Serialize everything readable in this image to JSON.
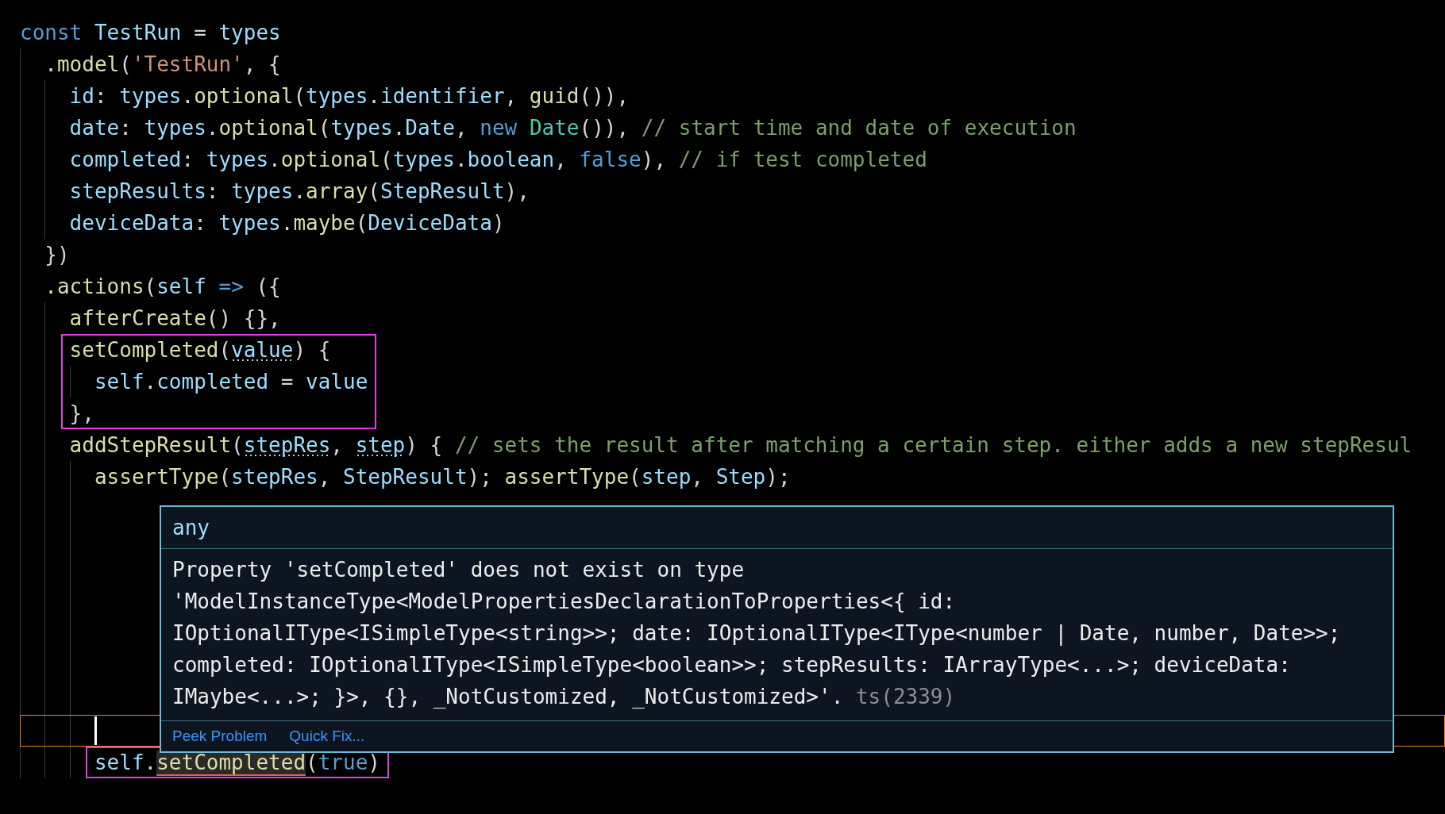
{
  "code_lines": [
    {
      "boxed": false,
      "tokens": [
        {
          "text": "const ",
          "kind": "kw"
        },
        {
          "text": "TestRun",
          "kind": "var"
        },
        {
          "text": " = ",
          "kind": "plain"
        },
        {
          "text": "types",
          "kind": "var"
        }
      ]
    },
    {
      "boxed": false,
      "tokens": [
        {
          "text": "  .model",
          "kind": "fn"
        },
        {
          "text": "(",
          "kind": "plain"
        },
        {
          "text": "'TestRun'",
          "kind": "str"
        },
        {
          "text": ", {",
          "kind": "plain"
        }
      ]
    },
    {
      "boxed": false,
      "tokens": [
        {
          "text": "    id",
          "kind": "var"
        },
        {
          "text": ": ",
          "kind": "plain"
        },
        {
          "text": "types",
          "kind": "var"
        },
        {
          "text": ".",
          "kind": "plain"
        },
        {
          "text": "optional",
          "kind": "fn"
        },
        {
          "text": "(",
          "kind": "plain"
        },
        {
          "text": "types",
          "kind": "var"
        },
        {
          "text": ".",
          "kind": "plain"
        },
        {
          "text": "identifier",
          "kind": "var"
        },
        {
          "text": ", ",
          "kind": "plain"
        },
        {
          "text": "guid",
          "kind": "fn"
        },
        {
          "text": "()),",
          "kind": "plain"
        }
      ]
    },
    {
      "boxed": false,
      "tokens": [
        {
          "text": "    date",
          "kind": "var"
        },
        {
          "text": ": ",
          "kind": "plain"
        },
        {
          "text": "types",
          "kind": "var"
        },
        {
          "text": ".",
          "kind": "plain"
        },
        {
          "text": "optional",
          "kind": "fn"
        },
        {
          "text": "(",
          "kind": "plain"
        },
        {
          "text": "types",
          "kind": "var"
        },
        {
          "text": ".",
          "kind": "plain"
        },
        {
          "text": "Date",
          "kind": "var"
        },
        {
          "text": ", ",
          "kind": "plain"
        },
        {
          "text": "new ",
          "kind": "kw"
        },
        {
          "text": "Date",
          "kind": "type"
        },
        {
          "text": "()), ",
          "kind": "plain"
        },
        {
          "text": "// start time and date of execution",
          "kind": "cmt"
        }
      ]
    },
    {
      "boxed": false,
      "tokens": [
        {
          "text": "    completed",
          "kind": "var"
        },
        {
          "text": ": ",
          "kind": "plain"
        },
        {
          "text": "types",
          "kind": "var"
        },
        {
          "text": ".",
          "kind": "plain"
        },
        {
          "text": "optional",
          "kind": "fn"
        },
        {
          "text": "(",
          "kind": "plain"
        },
        {
          "text": "types",
          "kind": "var"
        },
        {
          "text": ".",
          "kind": "plain"
        },
        {
          "text": "boolean",
          "kind": "var"
        },
        {
          "text": ", ",
          "kind": "plain"
        },
        {
          "text": "false",
          "kind": "kw"
        },
        {
          "text": "), ",
          "kind": "plain"
        },
        {
          "text": "// if test completed",
          "kind": "cmt"
        }
      ]
    },
    {
      "boxed": false,
      "tokens": [
        {
          "text": "    stepResults",
          "kind": "var"
        },
        {
          "text": ": ",
          "kind": "plain"
        },
        {
          "text": "types",
          "kind": "var"
        },
        {
          "text": ".",
          "kind": "plain"
        },
        {
          "text": "array",
          "kind": "fn"
        },
        {
          "text": "(",
          "kind": "plain"
        },
        {
          "text": "StepResult",
          "kind": "var"
        },
        {
          "text": "),",
          "kind": "plain"
        }
      ]
    },
    {
      "boxed": false,
      "tokens": [
        {
          "text": "    deviceData",
          "kind": "var"
        },
        {
          "text": ": ",
          "kind": "plain"
        },
        {
          "text": "types",
          "kind": "var"
        },
        {
          "text": ".",
          "kind": "plain"
        },
        {
          "text": "maybe",
          "kind": "fn"
        },
        {
          "text": "(",
          "kind": "plain"
        },
        {
          "text": "DeviceData",
          "kind": "var"
        },
        {
          "text": ")",
          "kind": "plain"
        }
      ]
    },
    {
      "boxed": false,
      "tokens": [
        {
          "text": "  })",
          "kind": "plain"
        }
      ]
    },
    {
      "boxed": false,
      "tokens": [
        {
          "text": "  .actions",
          "kind": "fn"
        },
        {
          "text": "(",
          "kind": "plain"
        },
        {
          "text": "self ",
          "kind": "var"
        },
        {
          "text": "=>",
          "kind": "kw"
        },
        {
          "text": " ({",
          "kind": "plain"
        }
      ]
    },
    {
      "boxed": false,
      "tokens": [
        {
          "text": "    afterCreate",
          "kind": "fn"
        },
        {
          "text": "() {},",
          "kind": "plain"
        }
      ]
    },
    {
      "boxed": true,
      "tokens": [
        {
          "text": "    setCompleted",
          "kind": "fn"
        },
        {
          "text": "(",
          "kind": "plain"
        },
        {
          "text": "value",
          "kind": "param"
        },
        {
          "text": ") {",
          "kind": "plain"
        }
      ]
    },
    {
      "boxed": true,
      "tokens": [
        {
          "text": "      self",
          "kind": "var"
        },
        {
          "text": ".",
          "kind": "plain"
        },
        {
          "text": "completed",
          "kind": "var"
        },
        {
          "text": " = ",
          "kind": "plain"
        },
        {
          "text": "value",
          "kind": "var"
        }
      ]
    },
    {
      "boxed": true,
      "tokens": [
        {
          "text": "    },",
          "kind": "plain"
        }
      ]
    },
    {
      "boxed": false,
      "tokens": [
        {
          "text": "    addStepResult",
          "kind": "fn"
        },
        {
          "text": "(",
          "kind": "plain"
        },
        {
          "text": "stepRes",
          "kind": "param"
        },
        {
          "text": ", ",
          "kind": "plain"
        },
        {
          "text": "step",
          "kind": "param"
        },
        {
          "text": ") { ",
          "kind": "plain"
        },
        {
          "text": "// sets the result after matching a certain step. either adds a new stepResul",
          "kind": "cmt"
        }
      ]
    },
    {
      "boxed": false,
      "tokens": [
        {
          "text": "      assertType",
          "kind": "fn"
        },
        {
          "text": "(",
          "kind": "plain"
        },
        {
          "text": "stepRes",
          "kind": "var"
        },
        {
          "text": ", ",
          "kind": "plain"
        },
        {
          "text": "StepResult",
          "kind": "var"
        },
        {
          "text": "); ",
          "kind": "plain"
        },
        {
          "text": "assertType",
          "kind": "fn"
        },
        {
          "text": "(",
          "kind": "plain"
        },
        {
          "text": "step",
          "kind": "var"
        },
        {
          "text": ", ",
          "kind": "plain"
        },
        {
          "text": "Step",
          "kind": "var"
        },
        {
          "text": ");",
          "kind": "plain"
        }
      ]
    }
  ],
  "code_lines_after_gap": [
    {
      "boxed": true,
      "tokens": [
        {
          "text": "      self",
          "kind": "var"
        },
        {
          "text": ".",
          "kind": "plain"
        },
        {
          "text": "setCompleted",
          "kind": "error"
        },
        {
          "text": "(",
          "kind": "plain"
        },
        {
          "text": "true",
          "kind": "kw"
        },
        {
          "text": ")",
          "kind": "plain"
        }
      ]
    }
  ],
  "hover": {
    "type": "any",
    "message": "Property 'setCompleted' does not exist on type 'ModelInstanceType<ModelPropertiesDeclarationToProperties<{ id: IOptionalIType<ISimpleType<string>>; date: IOptionalIType<IType<number | Date, number, Date>>; completed: IOptionalIType<ISimpleType<boolean>>; stepResults: IArrayType<...>; deviceData: IMaybe<...>; }>, {}, _NotCustomized, _NotCustomized>'.",
    "code": "ts(2339)",
    "actions": [
      "Peek Problem",
      "Quick Fix..."
    ]
  }
}
